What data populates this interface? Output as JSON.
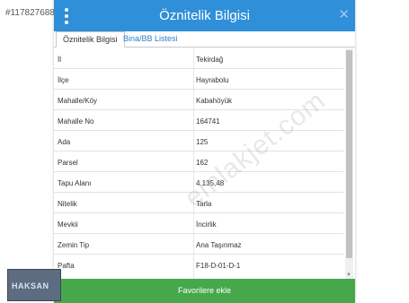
{
  "listing": {
    "id": "#117827688"
  },
  "header": {
    "title": "Öznitelik Bilgisi",
    "menu_icon": "vertical-dots-icon",
    "close_label": "✕"
  },
  "tabs": [
    {
      "label": "Öznitelik Bilgisi",
      "active": true
    },
    {
      "label": "Bina/BB Listesi",
      "active": false
    }
  ],
  "attributes": [
    {
      "key": "İl",
      "value": "Tekirdağ"
    },
    {
      "key": "İlçe",
      "value": "Hayrabolu"
    },
    {
      "key": "Mahalle/Köy",
      "value": "Kabahöyük"
    },
    {
      "key": "Mahalle No",
      "value": "164741"
    },
    {
      "key": "Ada",
      "value": "125"
    },
    {
      "key": "Parsel",
      "value": "162"
    },
    {
      "key": "Tapu Alanı",
      "value": "4.135,48"
    },
    {
      "key": "Nitelik",
      "value": "Tarla"
    },
    {
      "key": "Mevkii",
      "value": "İncirlik"
    },
    {
      "key": "Zemin Tip",
      "value": "Ana Taşınmaz"
    },
    {
      "key": "Pafta",
      "value": "F18-D-01-D-1"
    }
  ],
  "actions": {
    "favorite_label": "Favorilere ekle"
  },
  "watermark": {
    "text": "emlakjet.com"
  },
  "logo": {
    "text": "HAKSAN"
  },
  "colors": {
    "header": "#2f8fd8",
    "button": "#46a84b",
    "tab_link": "#2f7fc5"
  }
}
